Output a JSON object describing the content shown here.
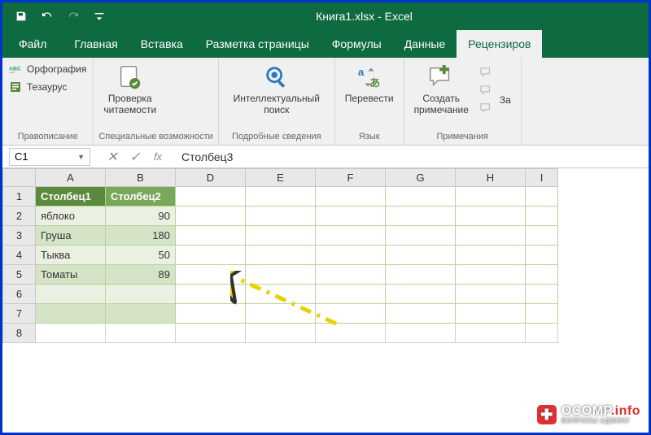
{
  "titlebar": {
    "title": "Книга1.xlsx  -  Excel"
  },
  "tabs": {
    "file": "Файл",
    "home": "Главная",
    "insert": "Вставка",
    "layout": "Разметка страницы",
    "formulas": "Формулы",
    "data": "Данные",
    "review": "Рецензиров"
  },
  "ribbon": {
    "proofing": {
      "spelling": "Орфография",
      "thesaurus": "Тезаурус",
      "group": "Правописание"
    },
    "accessibility": {
      "check": "Проверка\nчитаемости",
      "group": "Специальные возможности"
    },
    "insights": {
      "smart": "Интеллектуальный\nпоиск",
      "group": "Подробные сведения"
    },
    "language": {
      "translate": "Перевести",
      "group": "Язык"
    },
    "comments": {
      "new": "Создать\nпримечание",
      "group": "Примечания",
      "extra": "За"
    }
  },
  "formula_bar": {
    "namebox": "C1",
    "formula": "Столбец3"
  },
  "columns": [
    "A",
    "B",
    "D",
    "E",
    "F",
    "G",
    "H",
    "I"
  ],
  "rows": [
    "1",
    "2",
    "3",
    "4",
    "5",
    "6",
    "7",
    "8"
  ],
  "table": {
    "headers": {
      "a": "Столбец1",
      "b": "Столбец2"
    },
    "data": [
      {
        "a": "яблоко",
        "b": "90"
      },
      {
        "a": "Груша",
        "b": "180"
      },
      {
        "a": "Тыква",
        "b": "50"
      },
      {
        "a": "Томаты",
        "b": "89"
      }
    ]
  },
  "watermark": {
    "brand": "OCOMP",
    "tld": ".info",
    "sub": "ВОПРОСЫ АДМИНУ"
  }
}
